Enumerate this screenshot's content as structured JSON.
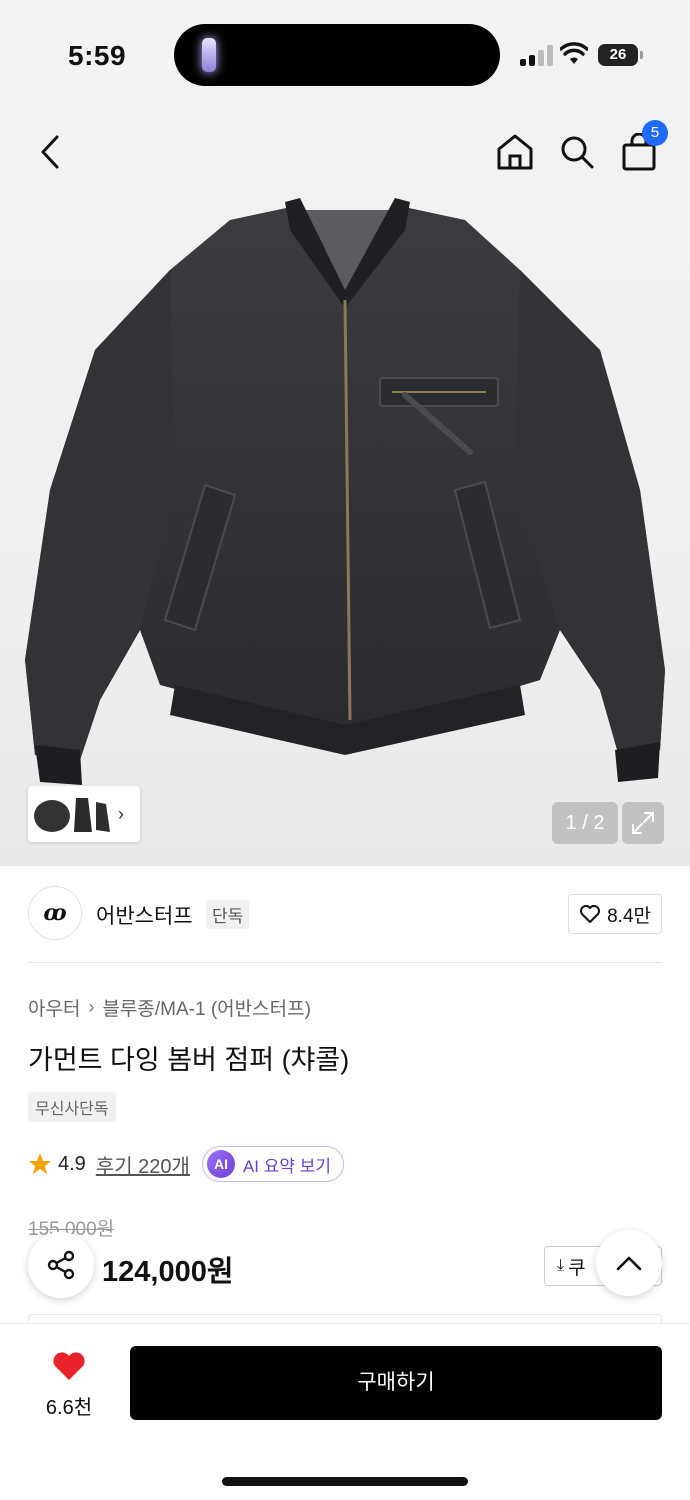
{
  "status_bar": {
    "time": "5:59",
    "battery": "26"
  },
  "header": {
    "cart_count": "5"
  },
  "gallery": {
    "counter": "1 / 2"
  },
  "brand": {
    "name": "어반스터프",
    "tag": "단독",
    "likes": "8.4만"
  },
  "breadcrumb": {
    "category": "아우터",
    "subcategory": "블루종/MA-1 (어반스터프)"
  },
  "product": {
    "title": "가먼트 다잉 봄버 점퍼 (챠콜)",
    "exclusive_tag": "무신사단독",
    "rating": "4.9",
    "review_link": "후기 220개",
    "ai_badge": "AI",
    "ai_summary": "AI 요약 보기",
    "original_price": "155,000원",
    "sale_price": "124,000원",
    "coupon_label": "쿠"
  },
  "bottom_bar": {
    "like_count": "6.6천",
    "buy_label": "구매하기"
  },
  "colors": {
    "accent_blue": "#1f6bff",
    "heart_red": "#e8222a",
    "ai_purple": "#6a3fd1",
    "star": "#f5a100"
  }
}
